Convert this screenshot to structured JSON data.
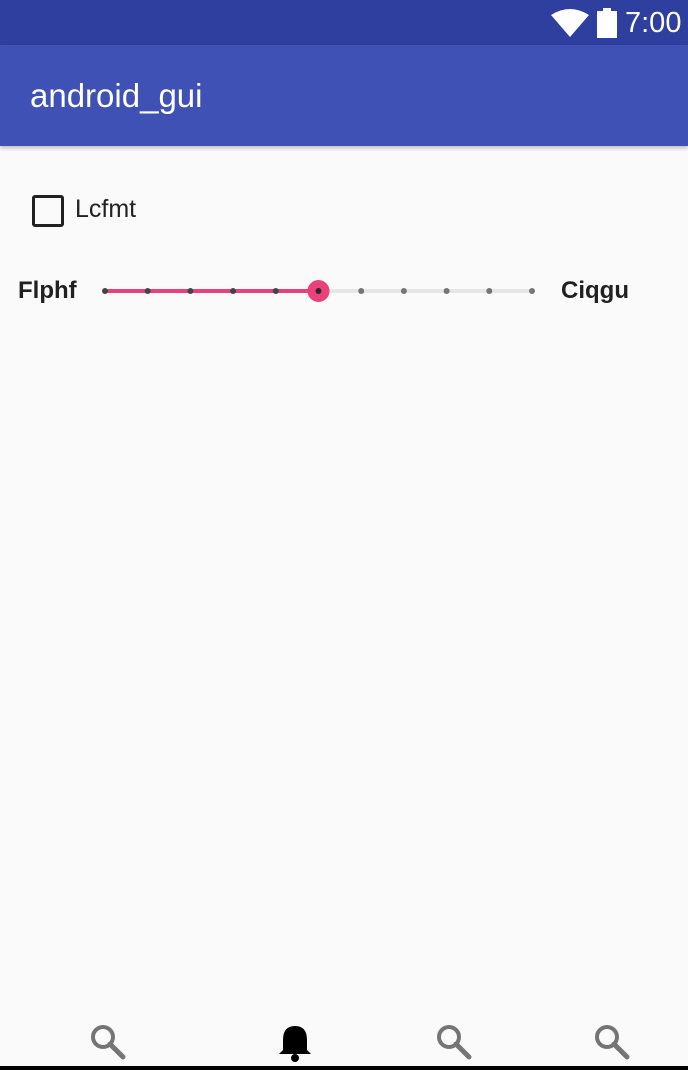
{
  "status_bar": {
    "time": "7:00",
    "icons": [
      "wifi-icon",
      "battery-icon"
    ],
    "background": "#2e3f9f"
  },
  "app_bar": {
    "title": "android_gui",
    "background": "#3f51b5"
  },
  "checkbox": {
    "label": "Lcfmt",
    "checked": false
  },
  "slider": {
    "left_label": "Flphf",
    "right_label": "Ciqgu",
    "min": 0,
    "max": 10,
    "value": 5,
    "accent": "#ec407a"
  },
  "bottom_nav": {
    "items": [
      {
        "icon": "search-icon",
        "selected": false
      },
      {
        "icon": "bell-icon",
        "selected": true
      },
      {
        "icon": "search-icon",
        "selected": false
      },
      {
        "icon": "search-icon",
        "selected": false
      }
    ]
  }
}
